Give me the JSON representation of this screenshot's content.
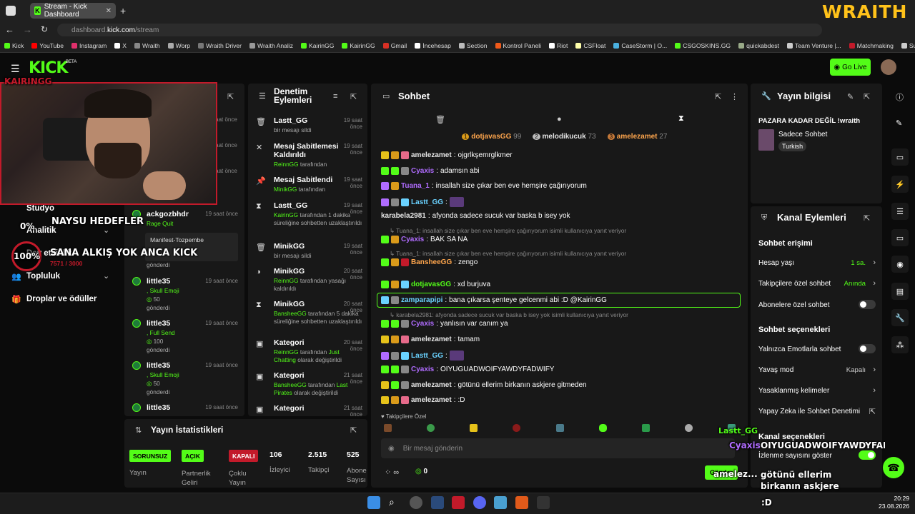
{
  "browser": {
    "tab_title": "Stream - Kick Dashboard",
    "url_prefix": "dashboard.",
    "url_domain": "kick.com",
    "url_path": "/stream",
    "bookmarks": [
      "Kick",
      "YouTube",
      "Instagram",
      "X",
      "Wraith",
      "Worp",
      "Wraith Driver",
      "Wraith Analiz",
      "KairinGG",
      "KairinGG",
      "Gmail",
      "İncehesap",
      "Section",
      "Kontrol Paneli",
      "Riot",
      "CSFloat",
      "CaseStorm | O...",
      "CSGOSKINS.GG",
      "quickabdest",
      "Team Venture |...",
      "Matchmaking",
      "Submit a reque..."
    ]
  },
  "brand": "WRAITH",
  "topnav": {
    "logo": "KICK",
    "beta": "BETA",
    "go_live": "Go Live"
  },
  "overlay": {
    "streamer_tag": "KAIRINGG",
    "goal1": "NAYSU HEDEFLER",
    "goal1_pct": "0%",
    "goal2": "SANA ALKIŞ YOK ANCA KICK",
    "goal2_pct": "100%",
    "goal2_count": "7571 / 3000"
  },
  "sidebar": {
    "items": [
      "Studyo",
      "Analitik",
      "Dev etkinlik",
      "Topluluk",
      "Droplar ve ödüller"
    ]
  },
  "events": {
    "items": [
      {
        "user": "ackgozbhdr",
        "sub": "Rage Quit",
        "time": "19 saat önce"
      },
      {
        "user": "Manifest-Tozpembe",
        "sub": "",
        "time": ""
      },
      {
        "user": "gönderdi",
        "sub": "",
        "time": ""
      },
      {
        "user": "little35",
        "sub": "Skull Emoji",
        "amount": "50",
        "sent": "gönderdi",
        "time": "19 saat önce"
      },
      {
        "user": "little35",
        "sub": "Full Send",
        "amount": "100",
        "sent": "gönderdi",
        "time": "19 saat önce"
      },
      {
        "user": "little35",
        "sub": "Skull Emoji",
        "amount": "50",
        "sent": "gönderdi",
        "time": "19 saat önce"
      },
      {
        "user": "little35",
        "sub": "",
        "time": "19 saat önce"
      }
    ],
    "time_top": [
      "19 saat önce",
      "19 saat önce",
      "19 saat önce"
    ]
  },
  "moderation": {
    "title1": "Denetim",
    "title2": "Eylemleri",
    "items": [
      {
        "title": "Lastt_GG",
        "desc": "bir mesajı sildi",
        "time": "19 saat önce"
      },
      {
        "title": "Mesaj Sabitlemesi Kaldırıldı",
        "actor": "ReinnGG",
        "desc": "tarafından",
        "time": "19 saat önce"
      },
      {
        "title": "Mesaj Sabitlendi",
        "actor": "MinikGG",
        "desc": "tarafından",
        "time": "19 saat önce"
      },
      {
        "title": "Lastt_GG",
        "actor": "KairinGG",
        "desc": "tarafından 1 dakika süreliğine sohbetten uzaklaştırıldı",
        "time": "19 saat önce"
      },
      {
        "title": "MinikGG",
        "desc": "bir mesajı sildi",
        "time": "19 saat önce"
      },
      {
        "title": "MinikGG",
        "actor": "ReinnGG",
        "desc": "tarafından yasağı kaldırıldı",
        "time": "20 saat önce"
      },
      {
        "title": "MinikGG",
        "actor": "BansheeGG",
        "desc": "tarafından 5 dakika süreliğine sohbetten uzaklaştırıldı",
        "time": "20 saat önce"
      },
      {
        "title": "Kategori",
        "actor": "ReinnGG",
        "desc": "tarafından",
        "cat": "Just Chatting",
        "desc2": "olarak değiştirildi",
        "time": "20 saat önce"
      },
      {
        "title": "Kategori",
        "actor": "BansheeGG",
        "desc": "tarafından",
        "cat": "Last Pirates",
        "desc2": "olarak değiştirildi",
        "time": "21 saat önce"
      },
      {
        "title": "Kategori",
        "time": "21 saat önce"
      }
    ]
  },
  "chat": {
    "title": "Sohbet",
    "leaders": [
      {
        "name": "dotjavasGG",
        "score": "99"
      },
      {
        "name": "melodikucuk",
        "score": "73"
      },
      {
        "name": "amelezamet",
        "score": "27"
      }
    ],
    "messages": [
      {
        "user": "amelezamet",
        "text": "ojgrlkşemrglkmer",
        "color": "#e6e6e6"
      },
      {
        "user": "Cyaxis",
        "text": "adamsın abi",
        "color": "#b06cff"
      },
      {
        "user": "Tuana_1",
        "text": "insallah size çıkar ben eve hemşire çağırıyorum",
        "color": "#b06cff"
      },
      {
        "user": "Lastt_GG",
        "text": "",
        "color": "#6ad2ff"
      },
      {
        "user": "karabela2981",
        "text": "afyonda sadece sucuk var baska b isey yok",
        "color": "#e6e6e6"
      },
      {
        "user": "Cyaxis",
        "text": "BAK SA NA",
        "color": "#b06cff"
      },
      {
        "user": "BansheeGG",
        "text": "zengo",
        "color": "#ffa64d"
      },
      {
        "user": "dotjavasGG",
        "text": "xd burjuva",
        "color": "#53fc18"
      },
      {
        "user": "zamparapipi",
        "text": "bana çıkarsa şenteye gelcenmi abi :D @KairinGG",
        "color": "#6ad2ff"
      },
      {
        "user": "Cyaxis",
        "text": "yanlısın var canım ya",
        "color": "#b06cff"
      },
      {
        "user": "amelezamet",
        "text": "tamam",
        "color": "#e6e6e6"
      },
      {
        "user": "Lastt_GG",
        "text": "",
        "color": "#6ad2ff"
      },
      {
        "user": "Cyaxis",
        "text": "OIYUGUADWOIFYAWDYFADWIFY",
        "color": "#b06cff"
      },
      {
        "user": "amelezamet",
        "text": "götünü ellerim birkanın askjere gitmeden",
        "color": "#e6e6e6"
      },
      {
        "user": "amelezamet",
        "text": ":D",
        "color": "#e6e6e6"
      }
    ],
    "replies": [
      "Tuana_1: insallah size çıkar ben eve hemşire çağırıyorum isimli kullanıcıya yanıt veriyor",
      "Tuana_1: insallah size çıkar ben eve hemşire çağırıyorum isimli kullanıcıya yanıt veriyor",
      "karabela2981: afyonda sadece sucuk var baska b isey yok isimli kullanıcıya yanıt veriyor"
    ],
    "followers_only": "Takipçilere Özel",
    "placeholder": "Bir mesaj gönderin",
    "points": "0",
    "send": "Gönder"
  },
  "stream_info": {
    "title": "Yayın bilgisi",
    "stream_title": "PAZARA KADAR DEĞİL !wraith",
    "category": "Sadece Sohbet",
    "language": "Turkish"
  },
  "channel_actions": {
    "title": "Kanal Eylemleri",
    "access_title": "Sohbet erişimi",
    "account_age": "Hesap yaşı",
    "account_age_val": "1 sa.",
    "followers_chat": "Takipçilere özel sohbet",
    "followers_chat_val": "Anında",
    "subs_chat": "Abonelere özel sohbet",
    "options_title": "Sohbet seçenekleri",
    "emote_only": "Yalnızca Emotlarla sohbet",
    "slow_mode": "Yavaş mod",
    "slow_mode_val": "Kapalı",
    "banned_words": "Yasaklanmış kelimeler",
    "ai_moderation": "Yapay Zeka ile Sohbet Denetimi",
    "channel_options": "Kanal seçenekleri",
    "show_views": "İzlenme sayısını göster"
  },
  "stats": {
    "title": "Yayın İstatistikleri",
    "stream_badge": "SORUNSUZ",
    "stream_label": "Yayın",
    "partner_badge": "AÇIK",
    "partner_label": "Partnerlik Geliri",
    "multi_badge": "KAPALI",
    "multi_label": "Çoklu Yayın",
    "viewers": "106",
    "viewers_label": "İzleyici",
    "followers": "2.515",
    "followers_label": "Takipçi",
    "subs": "525",
    "subs_label": "Abone Sayısı"
  },
  "overlay_chat": {
    "user1": "Lastt_GG",
    "user2": "Cyaxis",
    "text2": "OIYUGUADWOIFYAWDYFADWI",
    "text3": "götünü ellerim birkanın askjere gitmeden",
    "user3": "amelez...",
    "text4": ":D"
  },
  "taskbar": {
    "time": "20:29",
    "date": "23.08.2026"
  },
  "colors": {
    "accent": "#53fc18",
    "brand": "#ffc21a"
  }
}
